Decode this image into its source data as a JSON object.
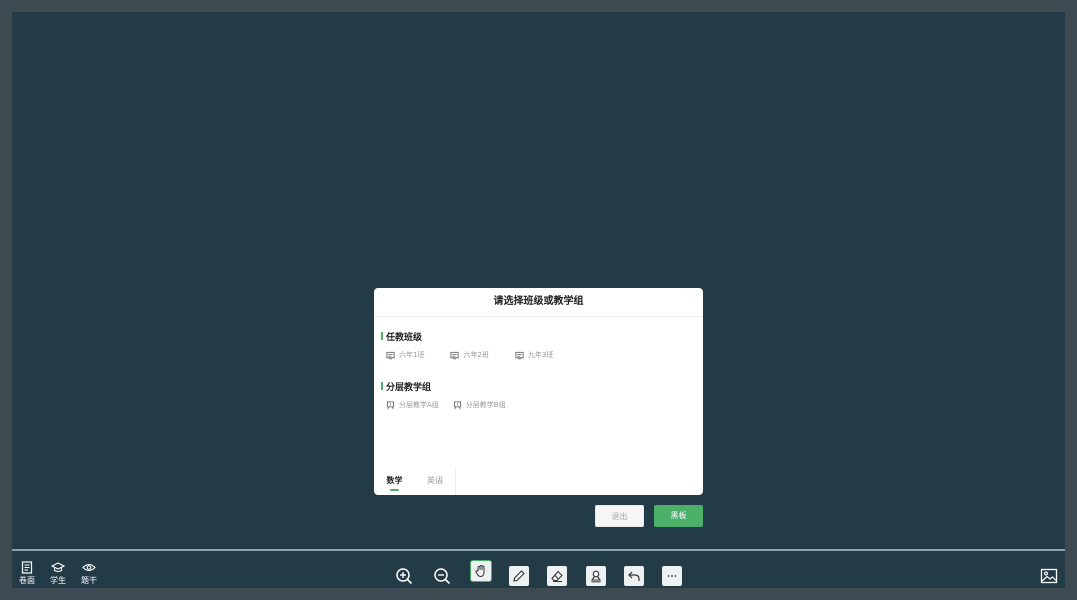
{
  "dialog": {
    "title": "请选择班级或教学组",
    "sections": [
      {
        "title": "任教班级",
        "items": [
          "六年1班",
          "六年2班",
          "九年3班"
        ]
      },
      {
        "title": "分层教学组",
        "items": [
          "分层教学A组",
          "分层教学B组"
        ]
      }
    ],
    "subject_tabs": [
      {
        "label": "数学",
        "active": true
      },
      {
        "label": "英语",
        "active": false
      }
    ]
  },
  "buttons": {
    "exit_label": "退出",
    "board_label": "黑板"
  },
  "toolbar": {
    "left": [
      {
        "label": "卷面",
        "icon": "paper-icon"
      },
      {
        "label": "学生",
        "icon": "graduation-cap-icon"
      },
      {
        "label": "题干",
        "icon": "eye-icon"
      }
    ],
    "center": [
      {
        "icon": "zoom-in-icon"
      },
      {
        "icon": "zoom-out-icon"
      },
      {
        "icon": "hand-icon",
        "active": true
      },
      {
        "icon": "pencil-icon"
      },
      {
        "icon": "eraser-icon"
      },
      {
        "icon": "stamp-icon"
      },
      {
        "icon": "undo-icon"
      },
      {
        "icon": "more-icon"
      }
    ],
    "right": {
      "icon": "image-icon"
    }
  },
  "colors": {
    "board_background": "#233a47",
    "accent_green": "#4caf6a",
    "outer_frame": "#3d4a52"
  }
}
